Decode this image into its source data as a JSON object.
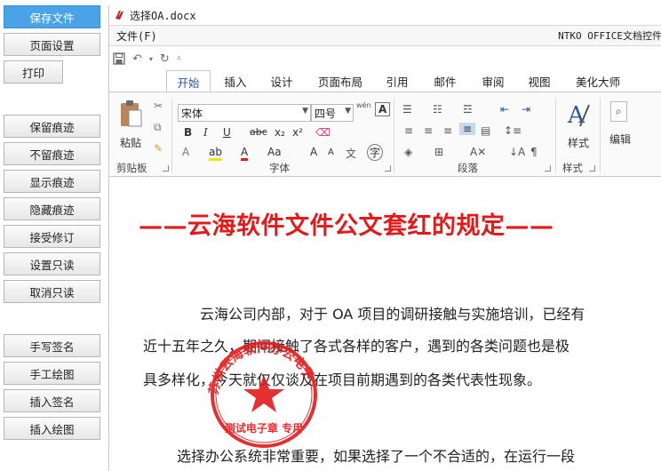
{
  "sidebar": {
    "buttons": [
      {
        "label": "保存文件",
        "active": true
      },
      {
        "label": "页面设置"
      },
      {
        "label": "打印"
      },
      {
        "label": "保留痕迹"
      },
      {
        "label": "不留痕迹"
      },
      {
        "label": "显示痕迹"
      },
      {
        "label": "隐藏痕迹"
      },
      {
        "label": "接受修订"
      },
      {
        "label": "设置只读"
      },
      {
        "label": "取消只读"
      },
      {
        "label": "手写签名"
      },
      {
        "label": "手工绘图"
      },
      {
        "label": "插入签名"
      },
      {
        "label": "插入绘图"
      }
    ]
  },
  "window": {
    "title": "选择OA.docx",
    "menu_file": "文件(F)",
    "menu_right": "NTKO OFFICE文档控件"
  },
  "ribbon": {
    "tabs": [
      "开始",
      "插入",
      "设计",
      "页面布局",
      "引用",
      "邮件",
      "审阅",
      "视图",
      "美化大师"
    ],
    "active_tab": "开始",
    "paste_label": "粘贴",
    "clipboard_label": "剪贴板",
    "font_name": "宋体",
    "font_size": "四号",
    "font_group": "字体",
    "paragraph_group": "段落",
    "styles_label": "样式",
    "styles_group": "样式",
    "edit_label": "编辑",
    "wen_label": "wén"
  },
  "document": {
    "title": "——云海软件文件公文套红的规定——",
    "para1_line1": "云海公司内部，对于 OA 项目的调研接触与实施培训，已经有",
    "para1_line2": "近十五年之久，期间接触了各式各样的客户，遇到的各类问题也是极",
    "para1_line3": "具多样化，今天就仅仅谈及在项目前期遇到的各类代表性现象。",
    "para2_line1": "选择办公系统非常重要，如果选择了一个不合适的，在运行一段"
  },
  "seal": {
    "text": "苏州云海软件办公电子",
    "bottom_text": "测试电子章 专用",
    "color": "#e21a1a"
  },
  "colors": {
    "accent": "#4aa3e6",
    "title_red": "#e21a1a",
    "tab_blue": "#2b579a"
  }
}
